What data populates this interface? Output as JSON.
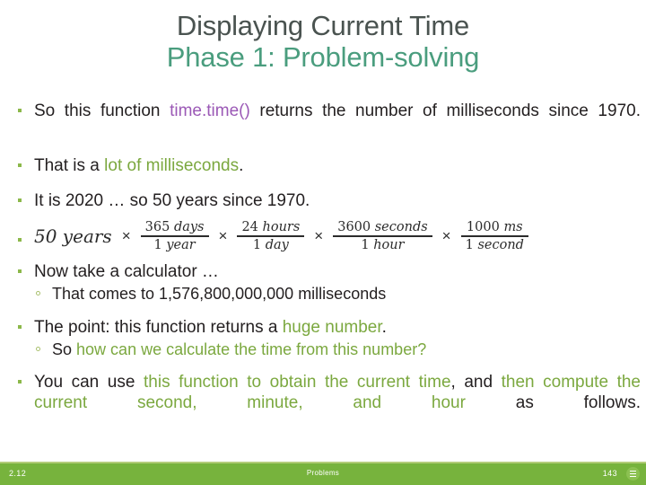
{
  "title": {
    "main": "Displaying Current Time",
    "subtitle": "Phase 1: Problem-solving",
    "main_color": "#4a5350",
    "subtitle_color": "#4a9d7e"
  },
  "colors": {
    "accent_green": "#7ba83f",
    "footer_green": "#77b33d",
    "code_purple": "#9b59b6",
    "body_dark": "#231f20"
  },
  "body": {
    "bullet1": {
      "part1": "So  this  function  ",
      "code": "time.time()",
      "part2": "  returns  the  number  of  milliseconds  since 1970."
    },
    "bullet2": {
      "part1": "That is a ",
      "highlight": "lot of milliseconds",
      "part2": "."
    },
    "bullet3": {
      "text": "It is 2020 … so 50 years since 1970."
    },
    "equation": {
      "lead": "50 years",
      "times": "×",
      "fractions": [
        {
          "numerator_value": "365",
          "numerator_unit": "days",
          "denominator_value": "1",
          "denominator_unit": "year"
        },
        {
          "numerator_value": "24",
          "numerator_unit": "hours",
          "denominator_value": "1",
          "denominator_unit": "day"
        },
        {
          "numerator_value": "3600",
          "numerator_unit": "seconds",
          "denominator_value": "1",
          "denominator_unit": "hour"
        },
        {
          "numerator_value": "1000",
          "numerator_unit": "ms",
          "denominator_value": "1",
          "denominator_unit": "second"
        }
      ]
    },
    "bullet4": {
      "text": "Now take a calculator …"
    },
    "subbullet4": {
      "text": "That comes to 1,576,800,000,000  milliseconds"
    },
    "bullet5": {
      "part1": "The point: this function returns a ",
      "highlight": "huge number",
      "part2": "."
    },
    "subbullet5": {
      "part1": "So ",
      "highlight": "how can we calculate the time from this number?"
    },
    "bullet6": {
      "part1": "You  can  use  ",
      "highlight1": "this  function  to  obtain  the  current  time",
      "part2": ",  and  ",
      "highlight2": "then  compute the current second, minute, and hour",
      "part3": " as follows."
    }
  },
  "footer": {
    "left": "2.12",
    "center": "Problems",
    "right": "143",
    "icon": "menu-lines-icon"
  }
}
